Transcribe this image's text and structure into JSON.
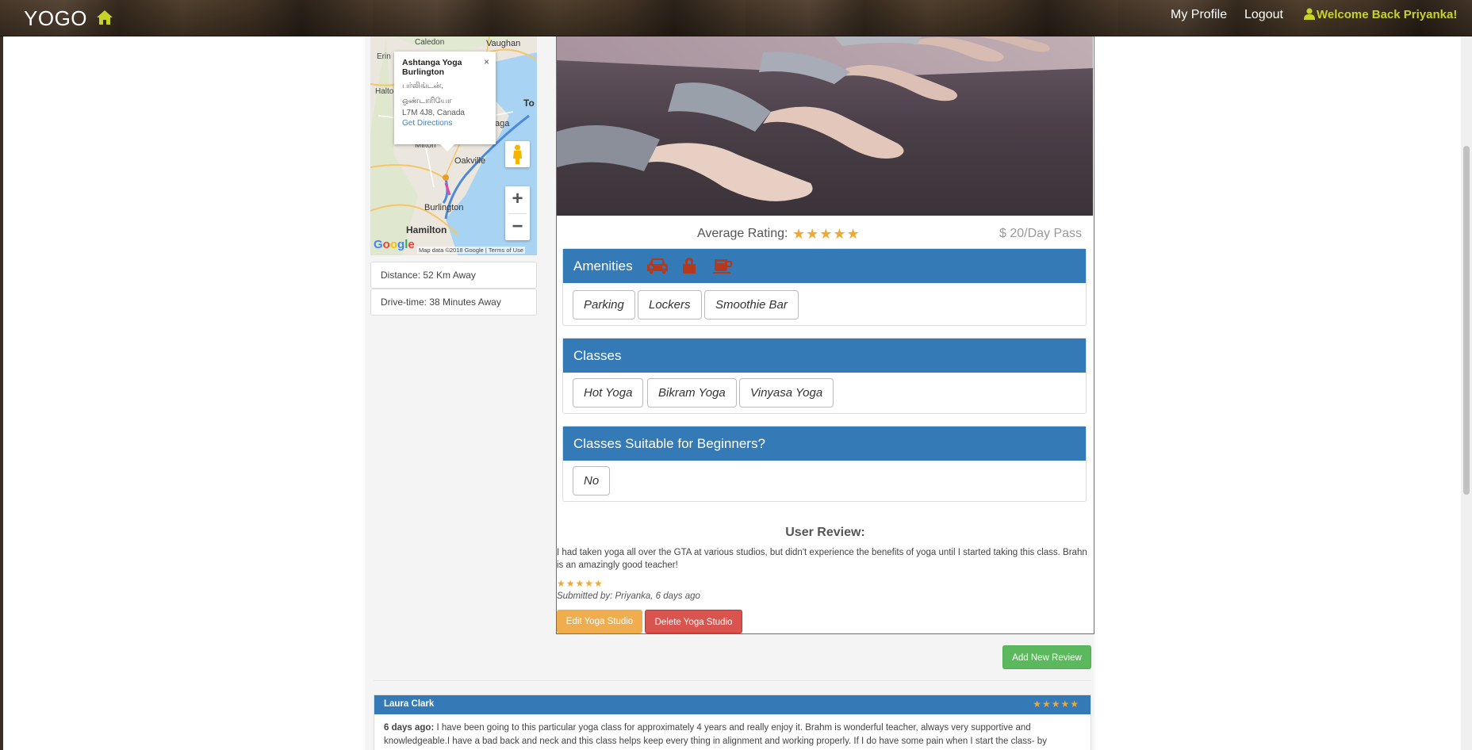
{
  "navbar": {
    "brand": "YOGO",
    "my_profile": "My Profile",
    "logout": "Logout",
    "welcome": "Welcome Back Priyanka!"
  },
  "map": {
    "popup": {
      "title": "Ashtanga Yoga Burlington",
      "line1": "பர்லிங்டன்,",
      "line2": "ஒண்டாரியோ",
      "line3": "L7M 4J8, Canada",
      "directions": "Get Directions",
      "close": "×"
    },
    "places": [
      "Caledon",
      "Vaughan",
      "Erin",
      "Halto",
      "Milton",
      "Oakville",
      "Burlington",
      "Hamilton",
      "To",
      "aga"
    ],
    "zoom_in": "+",
    "zoom_out": "−",
    "google": "Google",
    "footer": "Map data ©2018 Google  |  Terms of Use"
  },
  "info": {
    "distance": "Distance: 52 Km Away",
    "drive_time": "Drive-time: 38 Minutes Away"
  },
  "studio": {
    "average_rating_label": "Average Rating:",
    "average_rating": 5,
    "price": "$ 20/Day Pass",
    "amenities": {
      "title": "Amenities",
      "icons": [
        "car-icon",
        "lock-icon",
        "coffee-icon"
      ],
      "items": [
        "Parking",
        "Lockers",
        "Smoothie Bar"
      ]
    },
    "classes": {
      "title": "Classes",
      "items": [
        "Hot Yoga",
        "Bikram Yoga",
        "Vinyasa Yoga"
      ]
    },
    "beginners": {
      "title": "Classes Suitable for Beginners?",
      "value": "No"
    },
    "user_review": {
      "title": "User Review:",
      "text": "I had taken yoga all over the GTA at various studios, but didn't experience the benefits of yoga until I started taking this class. Brahn is an amazingly good teacher!",
      "rating": 5,
      "submitted": "Submitted by: Priyanka, 6 days ago"
    },
    "edit_button": "Edit Yoga Studio",
    "delete_button": "Delete Yoga Studio",
    "add_review_button": "Add New Review"
  },
  "reviews": [
    {
      "author": "Laura Clark",
      "rating": 5,
      "age": "6 days ago:",
      "text": "I have been going to this particular yoga class for approximately 4 years and really enjoy it. Brahm is wonderful teacher, always very supportive and knowledgeable.I have a bad back and neck and this class helps keep every thing in alignment and working properly. If I do have some pain when I start the class- by"
    }
  ],
  "colors": {
    "primary": "#347ab7",
    "warning": "#f0ad4e",
    "danger": "#d9534f",
    "success": "#5cb85c",
    "star": "#f0a830",
    "amenity_icon": "#b33a1d",
    "welcome": "#c8d32a"
  }
}
